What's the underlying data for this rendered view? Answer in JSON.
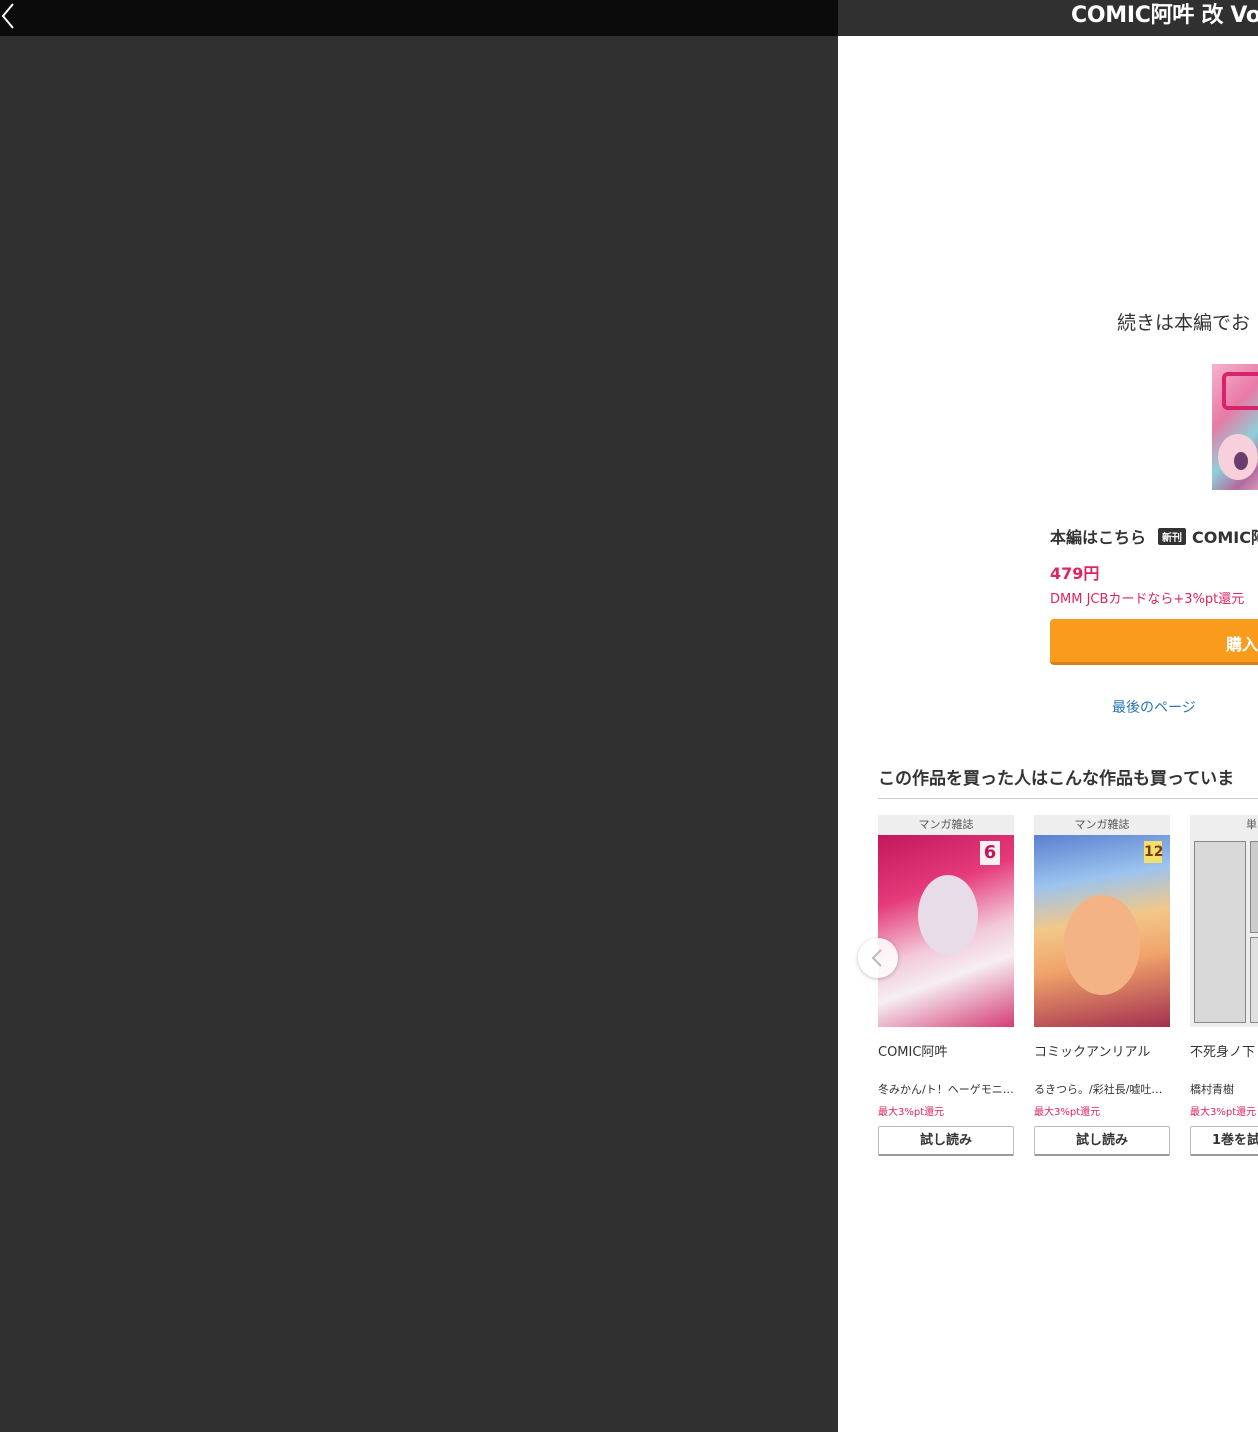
{
  "reader": {
    "title": "COMIC阿吽 改 Vo"
  },
  "end_panel": {
    "continue_text": "続きは本編でお",
    "main_label": "本編はこちら",
    "new_badge": "新刊",
    "main_title": "COMIC阿",
    "price": "479円",
    "card_offer": "DMM JCBカードなら+3%pt還元",
    "buy_label": "購入",
    "last_page_link": "最後のページ"
  },
  "recommendations": {
    "heading": "この作品を買った人はこんな作品も買っていま",
    "items": [
      {
        "category": "マンガ雑誌",
        "title": "COMIC阿吽",
        "author": "冬みかん/ト！ヘーゲモニ…",
        "points": "最大3%pt還元",
        "button": "試し読み"
      },
      {
        "category": "マンガ雑誌",
        "title": "コミックアンリアル",
        "author": "るきつら。/彩社長/嘘吐…",
        "points": "最大3%pt還元",
        "button": "試し読み"
      },
      {
        "category": "単",
        "title": "不死身ノ下",
        "author": "橋村青樹",
        "points": "最大3%pt還元",
        "button": "1巻を試"
      }
    ]
  },
  "colors": {
    "accent_orange": "#f99b1d",
    "price_red": "#e0245e",
    "link_blue": "#2a75b3",
    "topbar": "#0b0b0b",
    "background": "#303030"
  },
  "icons": {
    "back": "chevron-left-icon",
    "carousel_prev": "chevron-left-icon"
  }
}
